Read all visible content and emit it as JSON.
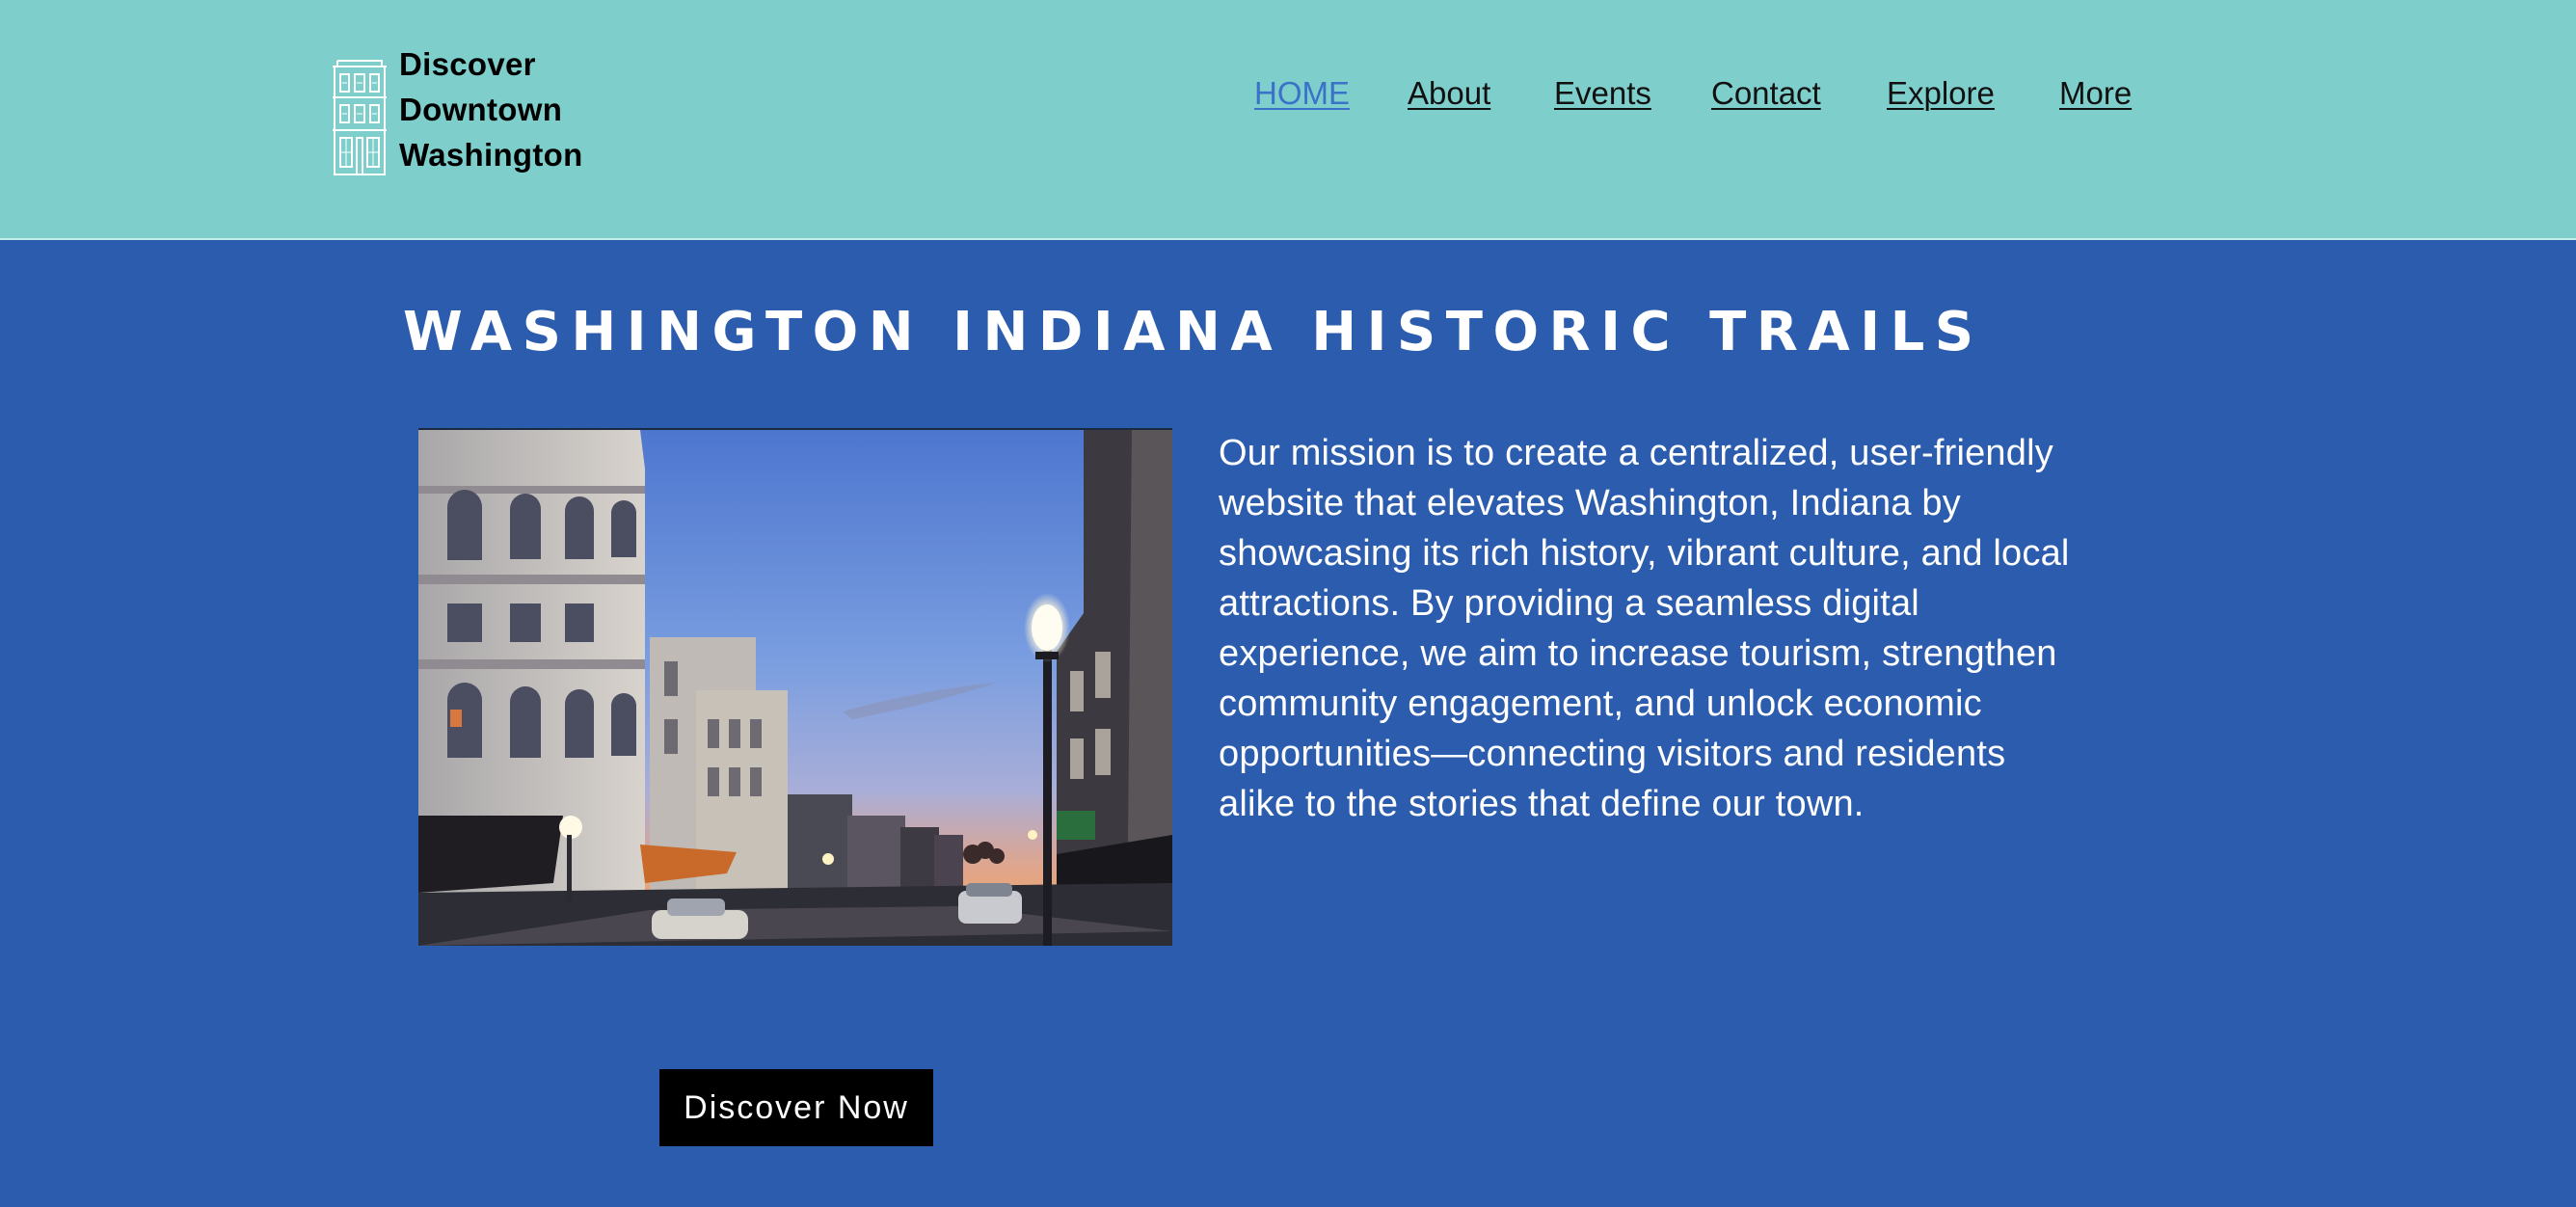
{
  "header": {
    "logo": {
      "icon": "building-facade-icon",
      "lines": [
        "Discover",
        "Downtown",
        "Washington"
      ]
    },
    "nav": [
      {
        "label": "HOME",
        "active": true
      },
      {
        "label": "About",
        "active": false
      },
      {
        "label": "Events",
        "active": false
      },
      {
        "label": "Contact",
        "active": false
      },
      {
        "label": "Explore",
        "active": false
      },
      {
        "label": "More",
        "active": false
      }
    ]
  },
  "hero": {
    "title": "WASHINGTON INDIANA HISTORIC TRAILS",
    "mission": "Our mission is to create a centralized, user-friendly website that elevates Washington, Indiana by showcasing its rich history, vibrant culture, and local attractions. By providing a seamless digital experience, we aim to increase tourism, strengthen community engagement, and unlock economic opportunities—connecting visitors and residents alike to the stories that define our town.",
    "cta_label": "Discover Now"
  },
  "colors": {
    "header_bg": "#7ecfcc",
    "page_bg": "#2c5cad",
    "nav_active": "#3a72c9",
    "button_bg": "#000000"
  }
}
